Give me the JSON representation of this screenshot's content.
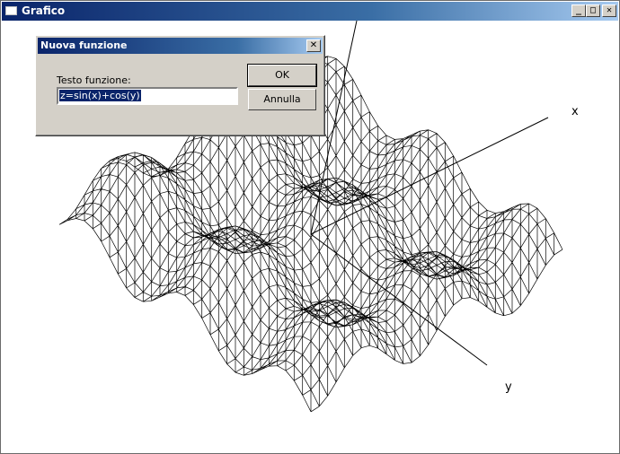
{
  "window": {
    "title": "Grafico"
  },
  "window_controls": {
    "minimize": "_",
    "maximize": "□",
    "close": "✕"
  },
  "axes": {
    "x_label": "x",
    "y_label": "y"
  },
  "dialog": {
    "title": "Nuova funzione",
    "close": "✕",
    "field_label": "Testo funzione:",
    "field_value": "z=sin(x)+cos(y)",
    "ok_label": "OK",
    "cancel_label": "Annulla"
  }
}
